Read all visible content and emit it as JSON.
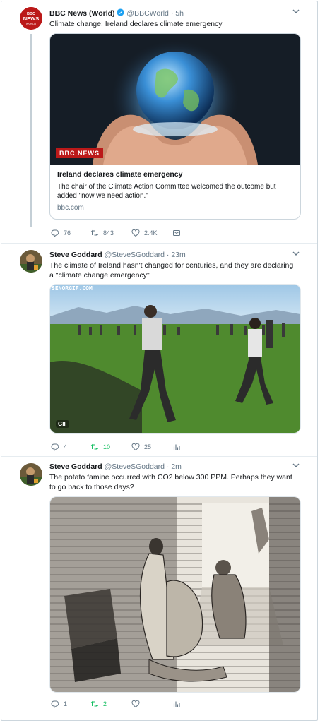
{
  "tweets": [
    {
      "name": "BBC News (World)",
      "handle": "@BBCWorld",
      "sep": "·",
      "time": "5h",
      "text": "Climate change: Ireland declares climate emergency",
      "avatar_text": [
        "BBC",
        "NEWS",
        "WORLD"
      ],
      "card": {
        "brand": "BBC NEWS",
        "title": "Ireland declares climate emergency",
        "desc": "The chair of the Climate Action Committee welcomed the outcome but added \"now we need action.\"",
        "domain": "bbc.com"
      },
      "replies": "76",
      "retweets": "843",
      "likes": "2.4K"
    },
    {
      "name": "Steve Goddard",
      "handle": "@SteveSGoddard",
      "sep": "·",
      "time": "23m",
      "text": "The climate of Ireland hasn't changed for centuries, and they are declaring a \"climate change emergency\"",
      "gif_watermark": "SENORGIF.COM",
      "gif_badge": "GIF",
      "replies": "4",
      "retweets": "10",
      "likes": "25"
    },
    {
      "name": "Steve Goddard",
      "handle": "@SteveSGoddard",
      "sep": "·",
      "time": "2m",
      "text": "The potato famine occurred with CO2 below 300 PPM.  Perhaps they want to go back to those days?",
      "replies": "1",
      "retweets": "2",
      "likes": ""
    }
  ],
  "colors": {
    "accent": "#1da1f2",
    "retweet_active": "#17bf63",
    "bbc_red": "#bb1919",
    "muted": "#657786"
  },
  "icons": [
    "verified-badge-icon",
    "chevron-down-icon",
    "reply-icon",
    "retweet-icon",
    "like-icon",
    "dm-icon",
    "analytics-icon"
  ]
}
